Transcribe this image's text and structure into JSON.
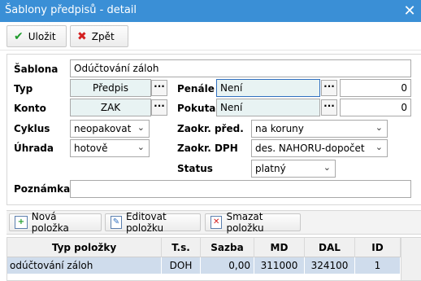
{
  "window": {
    "title": "Šablony předpisů - detail",
    "close_glyph": "✕"
  },
  "toolbar": {
    "save_label": "Uložit",
    "back_label": "Zpět",
    "save_icon_color": "#1e9b2b",
    "back_icon_color": "#d42020"
  },
  "form": {
    "sablona_label": "Šablona",
    "sablona_value": "Odúčtování záloh",
    "typ_label": "Typ",
    "typ_value": "Předpis",
    "penale_label": "Penále",
    "penale_value": "Není",
    "penale_amount": "0",
    "konto_label": "Konto",
    "konto_value": "ZAK",
    "pokuta_label": "Pokuta",
    "pokuta_value": "Není",
    "pokuta_amount": "0",
    "cyklus_label": "Cyklus",
    "cyklus_value": "neopakovat",
    "zaokr_pred_label": "Zaokr. před.",
    "zaokr_pred_value": "na koruny",
    "uhrada_label": "Úhrada",
    "uhrada_value": "hotově",
    "zaokr_dph_label": "Zaokr. DPH",
    "zaokr_dph_value": "des. NAHORU-dopočet",
    "status_label": "Status",
    "status_value": "platný",
    "poznamka_label": "Poznámka",
    "poznamka_value": "",
    "dots_glyph": "···",
    "chevron_glyph": "⌄"
  },
  "grid_toolbar": {
    "new_label": "Nová položka",
    "edit_label": "Editovat položku",
    "delete_label": "Smazat položku"
  },
  "grid": {
    "columns": [
      "Typ položky",
      "T.s.",
      "Sazba",
      "MD",
      "DAL",
      "ID"
    ],
    "rows": [
      {
        "typ": "odúčtování záloh",
        "ts": "DOH",
        "sazba": "0,00",
        "md": "311000",
        "dal": "324100",
        "id": "1"
      }
    ],
    "selected_row_color": "#cfdcec"
  },
  "colors": {
    "titlebar": "#3a8fd6",
    "field_tint": "#e8f3f3"
  }
}
